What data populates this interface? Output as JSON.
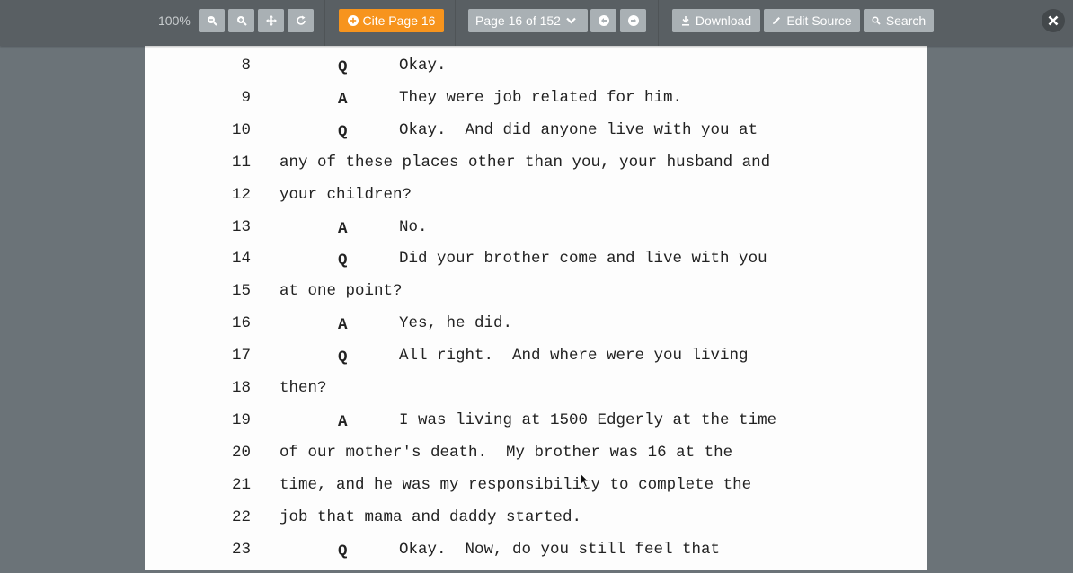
{
  "toolbar": {
    "zoom_level": "100%",
    "zoom_out_icon": "zoom-out-icon",
    "zoom_in_icon": "zoom-in-icon",
    "fit_icon": "move-arrows-icon",
    "rotate_icon": "rotate-icon",
    "cite_label": "Cite Page 16",
    "page_select_value": "Page 16 of 152",
    "download_label": "Download",
    "edit_source_label": "Edit Source",
    "search_label": "Search",
    "colors": {
      "toolbar_bg": "#595f63",
      "button_bg": "#a9b0b4",
      "accent": "#f7941d"
    }
  },
  "transcript": {
    "lines": [
      {
        "num": "8",
        "speaker": "Q",
        "text": "Okay."
      },
      {
        "num": "9",
        "speaker": "A",
        "text": "They were job related for him."
      },
      {
        "num": "10",
        "speaker": "Q",
        "text": "Okay.  And did anyone live with you at"
      },
      {
        "num": "11",
        "speaker": "",
        "text": "any of these places other than you, your husband and"
      },
      {
        "num": "12",
        "speaker": "",
        "text": "your children?"
      },
      {
        "num": "13",
        "speaker": "A",
        "text": "No."
      },
      {
        "num": "14",
        "speaker": "Q",
        "text": "Did your brother come and live with you"
      },
      {
        "num": "15",
        "speaker": "",
        "text": "at one point?"
      },
      {
        "num": "16",
        "speaker": "A",
        "text": "Yes, he did."
      },
      {
        "num": "17",
        "speaker": "Q",
        "text": "All right.  And where were you living"
      },
      {
        "num": "18",
        "speaker": "",
        "text": "then?"
      },
      {
        "num": "19",
        "speaker": "A",
        "text": "I was living at 1500 Edgerly at the time"
      },
      {
        "num": "20",
        "speaker": "",
        "text": "of our mother's death.  My brother was 16 at the"
      },
      {
        "num": "21",
        "speaker": "",
        "text": "time, and he was my responsibility to complete the"
      },
      {
        "num": "22",
        "speaker": "",
        "text": "job that mama and daddy started."
      },
      {
        "num": "23",
        "speaker": "Q",
        "text": "Okay.  Now, do you still feel that"
      }
    ]
  }
}
